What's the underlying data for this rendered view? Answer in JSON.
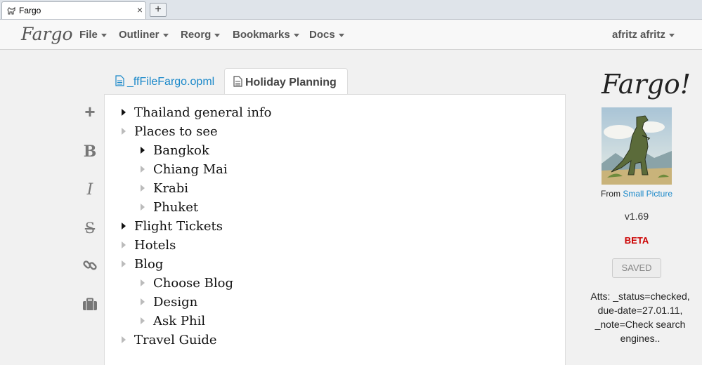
{
  "browser": {
    "tab_title": "Fargo",
    "close_glyph": "×",
    "new_tab_glyph": "+"
  },
  "navbar": {
    "brand": "Fargo",
    "menus": [
      "File",
      "Outliner",
      "Reorg",
      "Bookmarks",
      "Docs"
    ],
    "user": "afritz afritz"
  },
  "doc_tabs": [
    {
      "label": "_ffFileFargo.opml",
      "active": false
    },
    {
      "label": "Holiday Planning",
      "active": true
    }
  ],
  "toolbar": {
    "icons": [
      "plus-icon",
      "bold-icon",
      "italic-icon",
      "strikethrough-icon",
      "link-icon",
      "briefcase-icon"
    ],
    "bold_glyph": "B",
    "italic_glyph": "I",
    "strike_glyph": "S",
    "plus_glyph": "+"
  },
  "outline": [
    {
      "text": "Thailand general info",
      "level": 0,
      "collapsed": true
    },
    {
      "text": "Places to see",
      "level": 0,
      "collapsed": false
    },
    {
      "text": "Bangkok",
      "level": 1,
      "collapsed": true
    },
    {
      "text": "Chiang Mai",
      "level": 1,
      "collapsed": false
    },
    {
      "text": "Krabi",
      "level": 1,
      "collapsed": false
    },
    {
      "text": "Phuket",
      "level": 1,
      "collapsed": false
    },
    {
      "text": "Flight Tickets",
      "level": 0,
      "collapsed": true
    },
    {
      "text": "Hotels",
      "level": 0,
      "collapsed": false
    },
    {
      "text": "Blog",
      "level": 0,
      "collapsed": false
    },
    {
      "text": "Choose Blog",
      "level": 1,
      "collapsed": false
    },
    {
      "text": "Design",
      "level": 1,
      "collapsed": false
    },
    {
      "text": "Ask Phil",
      "level": 1,
      "collapsed": false
    },
    {
      "text": "Travel Guide",
      "level": 0,
      "collapsed": false
    }
  ],
  "sidebar": {
    "title": "Fargo!",
    "from_label": "From",
    "from_link": "Small Picture",
    "version": "v1.69",
    "beta": "BETA",
    "saved_button": "SAVED",
    "atts": "Atts: _status=checked, due-date=27.01.11, _note=Check search engines.."
  },
  "colors": {
    "link": "#1a88c9",
    "beta": "#cc0000",
    "page_bg": "#f1f1f1"
  }
}
